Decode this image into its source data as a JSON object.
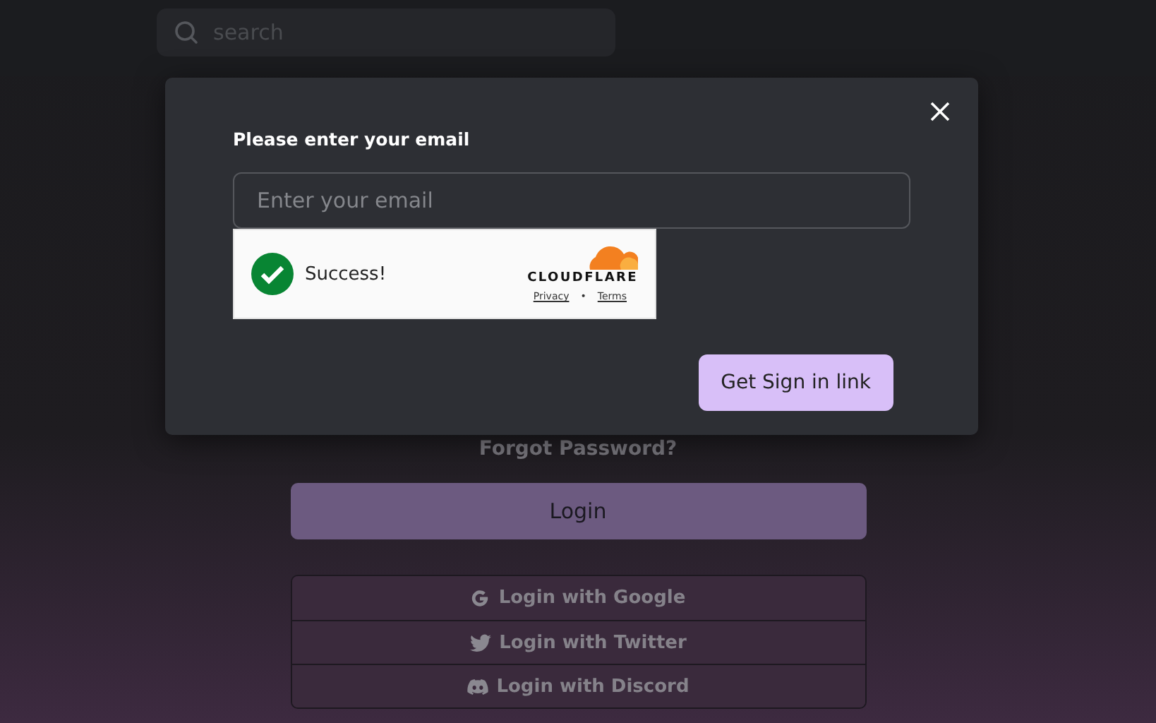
{
  "search": {
    "placeholder": "search"
  },
  "modal": {
    "title": "Please enter your email",
    "email": {
      "placeholder": "Enter your email"
    },
    "captcha": {
      "status": "Success!",
      "brand": "CLOUDFLARE",
      "links": [
        "Privacy",
        "Terms"
      ],
      "separator": "•"
    },
    "submit": "Get Sign in link"
  },
  "forgot_password": "Forgot Password?",
  "login_button": "Login",
  "social_logins": [
    {
      "kind": "google",
      "label": "Login with Google"
    },
    {
      "kind": "twitter",
      "label": "Login with Twitter"
    },
    {
      "kind": "discord",
      "label": "Login with Discord"
    }
  ]
}
